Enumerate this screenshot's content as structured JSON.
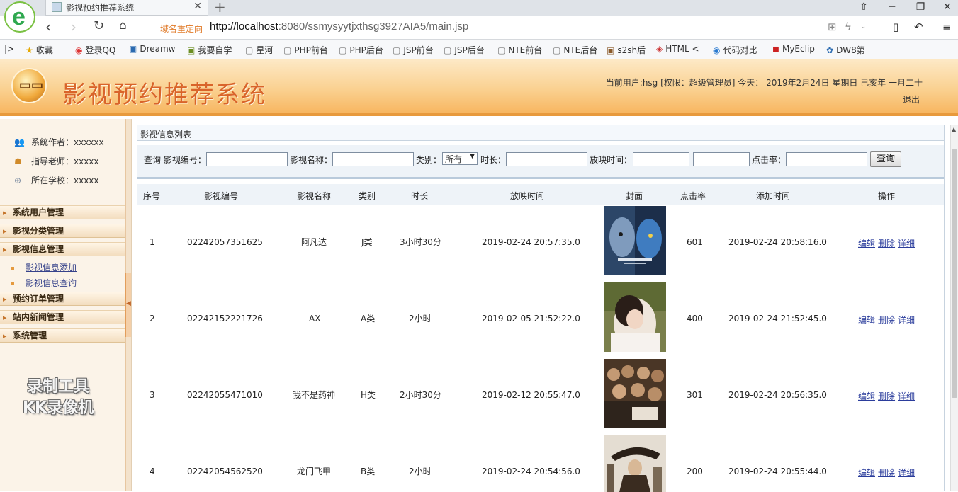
{
  "browser": {
    "tab_title": "影视预约推荐系统",
    "redirect_label": "域名重定向",
    "url_host": "http://localhost",
    "url_rest": ":8080/ssmysyytjxthsg3927AIA5/main.jsp",
    "bookmarks": [
      "收藏",
      "登录QQ",
      "Dreamw",
      "我要自学",
      "星河",
      "PHP前台",
      "PHP后台",
      "JSP前台",
      "JSP后台",
      "NTE前台",
      "NTE后台",
      "s2sh后",
      "HTML <",
      "代码对比",
      "MyEclip",
      "DW8第"
    ]
  },
  "header": {
    "title": "影视预约推荐系统",
    "info": "当前用户:hsg [权限：超级管理员] 今天：  2019年2月24日 星期日 己亥年 一月二十",
    "logout": "退出"
  },
  "sidebar": {
    "author": "系统作者：xxxxxx",
    "teacher": "指导老师：xxxxx",
    "school": "所在学校：xxxxx",
    "menus": [
      "系统用户管理",
      "影视分类管理",
      "影视信息管理",
      "预约订单管理",
      "站内新闻管理",
      "系统管理"
    ],
    "sub_items": [
      "影视信息添加",
      "影视信息查询"
    ],
    "watermark_line1": "录制工具",
    "watermark_line2": "KK录像机"
  },
  "panel": {
    "title": "影视信息列表"
  },
  "search": {
    "query_label": "查询 影视编号：",
    "name_label": "影视名称：",
    "category_label": "类别：",
    "category_value": "所有",
    "duration_label": "时长：",
    "showtime_label": "放映时间：",
    "separator": "-",
    "clicks_label": "点击率：",
    "button": "查询"
  },
  "table": {
    "headers": [
      "序号",
      "影视编号",
      "影视名称",
      "类别",
      "时长",
      "放映时间",
      "封面",
      "点击率",
      "添加时间",
      "操作"
    ],
    "rows": [
      {
        "no": "1",
        "code": "02242057351625",
        "name": "阿凡达",
        "category": "J类",
        "duration": "3小时30分",
        "showtime": "2019-02-24 20:57:35.0",
        "clicks": "601",
        "added": "2019-02-24 20:58:16.0"
      },
      {
        "no": "2",
        "code": "02242152221726",
        "name": "AX",
        "category": "A类",
        "duration": "2小时",
        "showtime": "2019-02-05 21:52:22.0",
        "clicks": "400",
        "added": "2019-02-24 21:52:45.0"
      },
      {
        "no": "3",
        "code": "02242055471010",
        "name": "我不是药神",
        "category": "H类",
        "duration": "2小时30分",
        "showtime": "2019-02-12 20:55:47.0",
        "clicks": "301",
        "added": "2019-02-24 20:56:35.0"
      },
      {
        "no": "4",
        "code": "02242054562520",
        "name": "龙门飞甲",
        "category": "B类",
        "duration": "2小时",
        "showtime": "2019-02-24 20:54:56.0",
        "clicks": "200",
        "added": "2019-02-24 20:55:44.0"
      }
    ],
    "op_edit": "编辑",
    "op_delete": "删除",
    "op_detail": "详细"
  }
}
